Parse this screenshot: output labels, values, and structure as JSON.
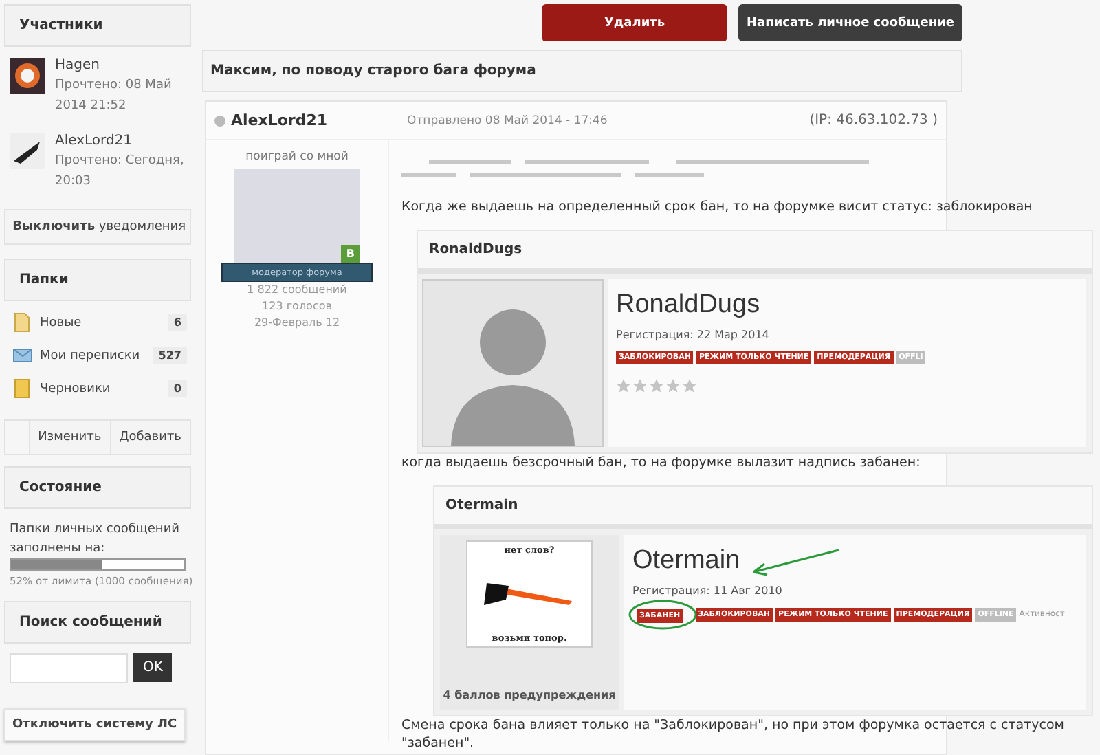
{
  "sidebar": {
    "participants": {
      "title": "Участники",
      "items": [
        {
          "name": "Hagen",
          "read": "Прочтено: 08 Май 2014 21:52"
        },
        {
          "name": "AlexLord21",
          "read": "Прочтено: Сегодня, 20:03"
        }
      ],
      "notify_button": "**Выключить** уведомления"
    },
    "folders": {
      "title": "Папки",
      "items": [
        {
          "kind": "new",
          "label": "Новые",
          "count": "6"
        },
        {
          "kind": "mail",
          "label": "Мои переписки",
          "count": "527"
        },
        {
          "kind": "drafts",
          "label": "Черновики",
          "count": "0"
        }
      ],
      "buttons": [
        "Изменить",
        "Добавить"
      ]
    },
    "status": {
      "title": "Состояние",
      "text": "Папки личных сообщений заполнены на:",
      "level": 0.52,
      "note": "52% от лимита (1000 сообщения)"
    },
    "search": {
      "title": "Поиск сообщений",
      "button": "OK"
    },
    "disable_button": "Отключить систему ЛС"
  },
  "actions": [
    {
      "kind": "danger",
      "label": "Удалить"
    },
    {
      "kind": "dark",
      "label": "Написать личное сообщение"
    }
  ],
  "topic_title": "Максим, по поводу старого бага форума",
  "post": {
    "author": "AlexLord21",
    "online": false,
    "sent": "Отправлено 08 Май 2014 - 17:46",
    "ip": "(IP: 46.63.102.73 )",
    "user_title": "поиграй со мной",
    "group_badge": "B",
    "group": "модератор форума",
    "stats": [
      "1 822 сообщений",
      "123 голосов",
      "29-Февраль 12"
    ],
    "paragraphs": [
      "Когда же выдаешь на определенный срок бан, то на форумке висит статус: заблокирован",
      "когда выдаешь безсрочный бан, то на форумке вылазит надпись забанен:",
      "Смена срока бана влияет только на \"Заблокирован\", но при этом форумка остается с статусом \"забанен\"."
    ],
    "shots": [
      {
        "header": "RonaldDugs",
        "name": "RonaldDugs",
        "reg": "Регистрация: 22 Мар 2014",
        "kind": "silhouette",
        "stars": 0,
        "badges": [
          {
            "label": "ЗАБЛОКИРОВАН",
            "color": "#b52a1c"
          },
          {
            "label": "РЕЖИМ ТОЛЬКО ЧТЕНИЕ",
            "color": "#b52a1c"
          },
          {
            "label": "ПРЕМОДЕРАЦИЯ",
            "color": "#b52a1c"
          },
          {
            "label": "OFFLI",
            "color": "#bdbdbd"
          }
        ]
      },
      {
        "header": "Otermain",
        "name": "Otermain",
        "reg": "Регистрация: 11 Авг 2010",
        "kind": "axe",
        "caption_top": "нет слов?",
        "caption_bottom": "возьми топор.",
        "warnings": "4 баллов предупреждения",
        "activity": "Активност",
        "badges": [
          {
            "label": "ЗАБАНЕН",
            "color": "#b52a1c"
          },
          {
            "label": "ЗАБЛОКИРОВАН",
            "color": "#b52a1c"
          },
          {
            "label": "РЕЖИМ ТОЛЬКО ЧТЕНИЕ",
            "color": "#b52a1c"
          },
          {
            "label": "ПРЕМОДЕРАЦИЯ",
            "color": "#b52a1c"
          },
          {
            "label": "OFFLINE",
            "color": "#bdbdbd"
          }
        ]
      }
    ]
  }
}
